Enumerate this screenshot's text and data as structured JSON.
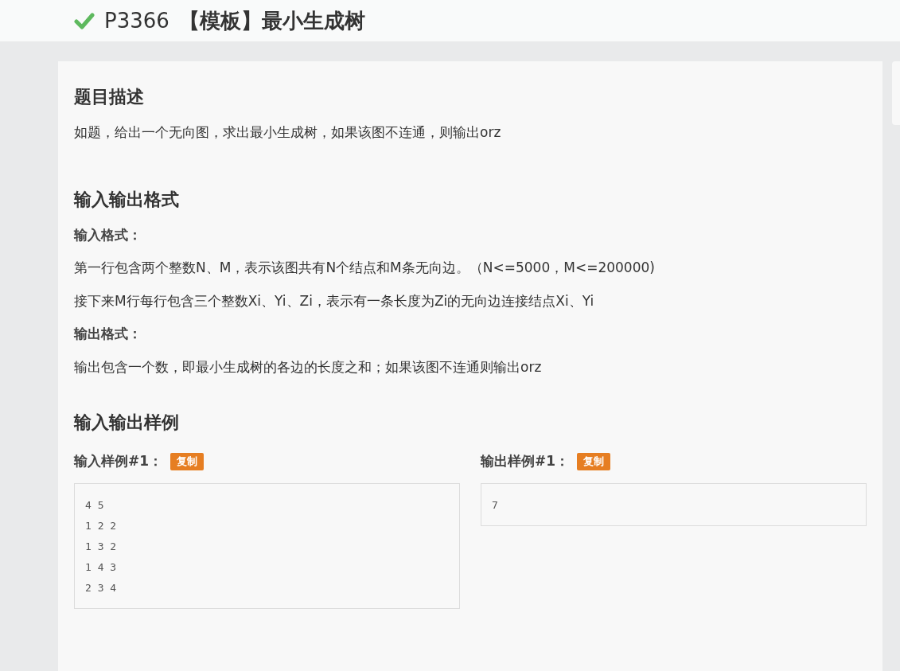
{
  "problem": {
    "solved": true,
    "id": "P3366",
    "name": "【模板】最小生成树"
  },
  "sections": [
    {
      "heading": "题目描述",
      "blocks": [
        {
          "kind": "paragraph",
          "text": "如题，给出一个无向图，求出最小生成树，如果该图不连通，则输出orz"
        }
      ]
    },
    {
      "heading": "输入输出格式",
      "blocks": [
        {
          "kind": "subheading",
          "text": "输入格式："
        },
        {
          "kind": "paragraph",
          "text": "第一行包含两个整数N、M，表示该图共有N个结点和M条无向边。（N<=5000，M<=200000)"
        },
        {
          "kind": "paragraph",
          "text": "接下来M行每行包含三个整数Xi、Yi、Zi，表示有一条长度为Zi的无向边连接结点Xi、Yi"
        },
        {
          "kind": "subheading",
          "text": "输出格式："
        },
        {
          "kind": "paragraph",
          "text": "输出包含一个数，即最小生成树的各边的长度之和；如果该图不连通则输出orz"
        }
      ]
    }
  ],
  "samples_heading": "输入输出样例",
  "samples": [
    {
      "label": "输入样例#1：",
      "copy": "复制",
      "lines": [
        "4 5",
        "1 2 2",
        "1 3 2",
        "1 4 3",
        "2 3 4"
      ]
    },
    {
      "label": "输出样例#1：",
      "copy": "复制",
      "lines": [
        "7"
      ]
    }
  ]
}
